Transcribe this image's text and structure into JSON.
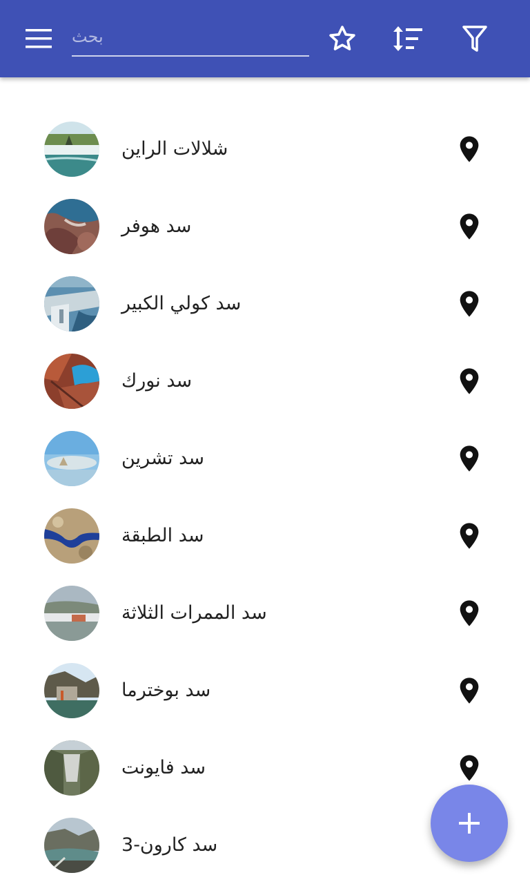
{
  "colors": {
    "toolbar": "#3f51b5",
    "fab": "#7986e8",
    "text": "#212121",
    "pin": "#111111"
  },
  "header": {
    "menu_icon": "hamburger-menu-icon",
    "search": {
      "placeholder": "بحث",
      "value": ""
    },
    "actions": [
      {
        "icon": "star-outline-icon"
      },
      {
        "icon": "sort-icon"
      },
      {
        "icon": "filter-icon"
      }
    ]
  },
  "items": [
    {
      "title": "شلالات الراين",
      "pin_icon": "map-marker-icon"
    },
    {
      "title": "سد هوفر",
      "pin_icon": "map-marker-icon"
    },
    {
      "title": "سد كولي الكبير",
      "pin_icon": "map-marker-icon"
    },
    {
      "title": "سد نورك",
      "pin_icon": "map-marker-icon"
    },
    {
      "title": "سد تشرين",
      "pin_icon": "map-marker-icon"
    },
    {
      "title": "سد الطبقة",
      "pin_icon": "map-marker-icon"
    },
    {
      "title": "سد الممرات الثلاثة",
      "pin_icon": "map-marker-icon"
    },
    {
      "title": "سد بوخترما",
      "pin_icon": "map-marker-icon"
    },
    {
      "title": "سد فايونت",
      "pin_icon": "map-marker-icon"
    },
    {
      "title": "سد كارون-3",
      "pin_icon": "map-marker-icon"
    }
  ],
  "fab": {
    "icon": "plus-icon"
  }
}
